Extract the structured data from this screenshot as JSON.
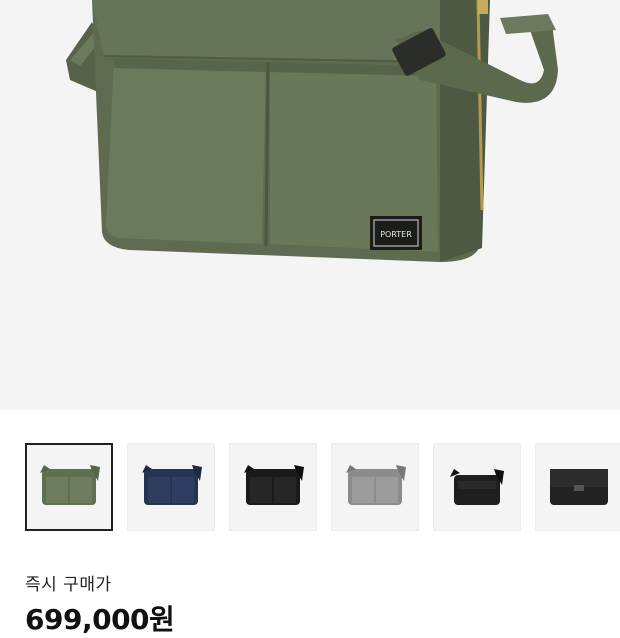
{
  "hero": {
    "image": "product-photo-sage-green-shoulder-bag",
    "label_logo": "PORTER"
  },
  "thumbnails": [
    {
      "color": "#5f6f52",
      "selected": true
    },
    {
      "color": "#263453",
      "selected": false
    },
    {
      "color": "#1a1a1a",
      "selected": false
    },
    {
      "color": "#8c8c8c",
      "selected": false
    },
    {
      "color": "#1e1e1e",
      "selected": false
    },
    {
      "color": "#222222",
      "selected": false
    }
  ],
  "price": {
    "label": "즉시 구매가",
    "value": "699,000원"
  }
}
